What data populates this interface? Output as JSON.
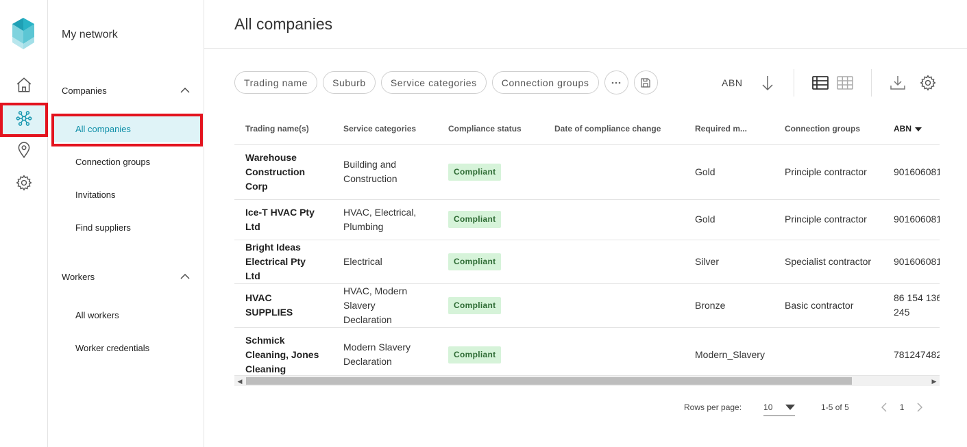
{
  "rail": {
    "items": [
      {
        "icon": "home-icon"
      },
      {
        "icon": "network-icon",
        "active": true
      },
      {
        "icon": "location-pin-icon"
      },
      {
        "icon": "gear-icon"
      }
    ]
  },
  "subnav": {
    "title": "My network",
    "sections": [
      {
        "label": "Companies",
        "items": [
          "All companies",
          "Connection groups",
          "Invitations",
          "Find suppliers"
        ]
      },
      {
        "label": "Workers",
        "items": [
          "All workers",
          "Worker credentials"
        ]
      }
    ]
  },
  "main": {
    "title": "All companies",
    "filters": [
      "Trading name",
      "Suburb",
      "Service categories",
      "Connection groups"
    ],
    "sort_field": "ABN"
  },
  "table": {
    "columns": [
      "Trading name(s)",
      "Service categories",
      "Compliance status",
      "Date of compliance change",
      "Required m...",
      "Connection groups",
      "ABN"
    ],
    "rows": [
      {
        "name": "Warehouse Construction Corp",
        "categories": "Building and Construction",
        "status": "Compliant",
        "date": "",
        "required": "Gold",
        "groups": "Principle contractor",
        "abn": "901606081"
      },
      {
        "name": "Ice-T HVAC Pty Ltd",
        "categories": "HVAC, Electrical, Plumbing",
        "status": "Compliant",
        "date": "",
        "required": "Gold",
        "groups": "Principle contractor",
        "abn": "901606081"
      },
      {
        "name": "Bright Ideas Electrical Pty Ltd",
        "categories": "Electrical",
        "status": "Compliant",
        "date": "",
        "required": "Silver",
        "groups": "Specialist contractor",
        "abn": "901606081"
      },
      {
        "name": "HVAC SUPPLIES",
        "categories": "HVAC, Modern Slavery Declaration",
        "status": "Compliant",
        "date": "",
        "required": "Bronze",
        "groups": "Basic contractor",
        "abn": "86 154 136 245"
      },
      {
        "name": "Schmick Cleaning, Jones Cleaning",
        "categories": "Modern Slavery Declaration",
        "status": "Compliant",
        "date": "",
        "required": "Modern_Slavery",
        "groups": "",
        "abn": "781247482"
      }
    ]
  },
  "pagination": {
    "rows_per_page_label": "Rows per page:",
    "rows_per_page": "10",
    "range": "1-5 of 5",
    "page": "1"
  },
  "colors": {
    "accent": "#0f8fa8",
    "active_bg": "#dff3f7",
    "highlight_box": "#e3131e",
    "compliant_bg": "#d6f3d9",
    "compliant_text": "#2e6b34"
  }
}
